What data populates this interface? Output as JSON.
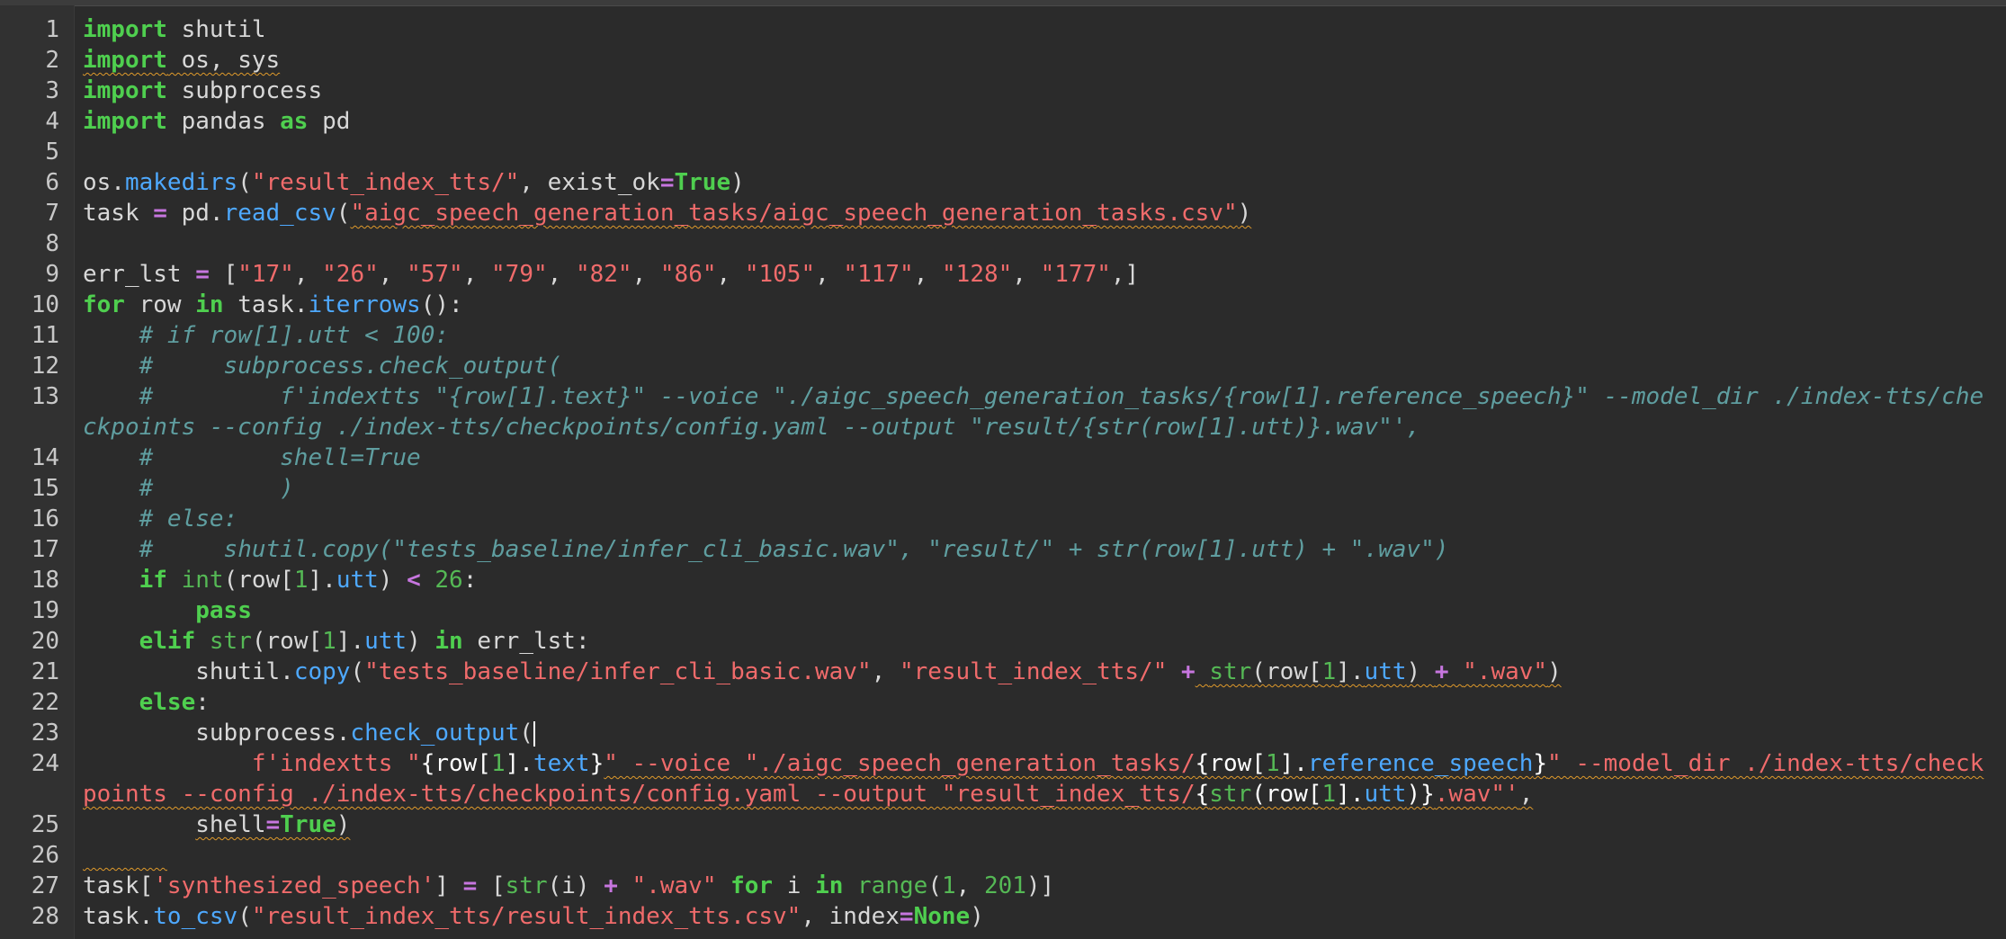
{
  "editor": {
    "language": "python",
    "colors": {
      "background": "#2b2b2b",
      "gutter": "#313131",
      "keyword": "#4fcf4f",
      "function": "#4ea9ff",
      "string": "#f06b6b",
      "operator": "#c776df",
      "comment": "#5f9ea0",
      "warning_underline": "#e09a2b"
    },
    "cursor": {
      "line": 23,
      "after_text": "subprocess.check_output("
    },
    "line_numbers": [
      "1",
      "2",
      "3",
      "4",
      "5",
      "6",
      "7",
      "8",
      "9",
      "10",
      "11",
      "12",
      "13",
      "14",
      "15",
      "16",
      "17",
      "18",
      "19",
      "20",
      "21",
      "22",
      "23",
      "24",
      "25",
      "26",
      "27",
      "28"
    ],
    "code": {
      "l1": {
        "kw": "import",
        "rest": " shutil"
      },
      "l2": {
        "kw": "import",
        "rest": " os, sys"
      },
      "l3": {
        "kw": "import",
        "rest": " subprocess"
      },
      "l4": {
        "kw": "import",
        "a": " pandas ",
        "kw2": "as",
        "b": " pd"
      },
      "l6": {
        "a": "os.",
        "fn": "makedirs",
        "b": "(",
        "s": "\"result_index_tts/\"",
        "c": ", exist_ok",
        "op": "=",
        "kw": "True",
        "d": ")"
      },
      "l7": {
        "a": "task ",
        "op": "=",
        "b": " pd.",
        "fn": "read_csv",
        "c": "(",
        "s": "\"aigc_speech_generation_tasks/aigc_speech_generation_tasks.csv\"",
        "d": ")"
      },
      "l9": {
        "a": "err_lst ",
        "op": "=",
        "b": " [",
        "items": [
          "\"17\"",
          "\"26\"",
          "\"57\"",
          "\"79\"",
          "\"82\"",
          "\"86\"",
          "\"105\"",
          "\"117\"",
          "\"128\"",
          "\"177\""
        ],
        "c": ",]"
      },
      "l10": {
        "kw": "for",
        "a": " row ",
        "kw2": "in",
        "b": " task.",
        "fn": "iterrows",
        "c": "():"
      },
      "l11": "    # if row[1].utt < 100:",
      "l12": "    #     subprocess.check_output(",
      "l13": "    #         f'indextts \"{row[1].text}\" --voice \"./aigc_speech_generation_tasks/{row[1].reference_speech}\" --model_dir ./index-tts/checkpoints --config ./index-tts/checkpoints/config.yaml --output \"result/{str(row[1].utt)}.wav\"',",
      "l14": "    #         shell=True",
      "l15": "    #         )",
      "l16": "    # else:",
      "l17": "    #     shutil.copy(\"tests_baseline/infer_cli_basic.wav\", \"result/\" + str(row[1].utt) + \".wav\")",
      "l18": {
        "indent": "    ",
        "kw": "if",
        "sp": " ",
        "bi": "int",
        "a": "(row[",
        "n1": "1",
        "b": "].",
        "attr": "utt",
        "c": ") ",
        "op": "<",
        "d": " ",
        "n2": "26",
        "e": ":"
      },
      "l19": {
        "indent": "        ",
        "kw": "pass"
      },
      "l20": {
        "indent": "    ",
        "kw": "elif",
        "sp": " ",
        "bi": "str",
        "a": "(row[",
        "n1": "1",
        "b": "].",
        "attr": "utt",
        "c": ") ",
        "kw2": "in",
        "d": " err_lst:"
      },
      "l21": {
        "indent": "        ",
        "a": "shutil.",
        "fn": "copy",
        "b": "(",
        "s1": "\"tests_baseline/infer_cli_basic.wav\"",
        "c": ", ",
        "s2": "\"result_index_tts/\"",
        "d": " ",
        "op": "+",
        "e": " ",
        "bi": "str",
        "f": "(row[",
        "n1": "1",
        "g": "].",
        "attr": "utt",
        "h": ") ",
        "op2": "+",
        "i": " ",
        "s3": "\".wav\"",
        "j": ")"
      },
      "l22": {
        "indent": "    ",
        "kw": "else",
        "rest": ":"
      },
      "l23": {
        "indent": "        ",
        "a": "subprocess.",
        "fn": "check_output",
        "b": "("
      },
      "l24": {
        "indent": "            ",
        "s1": "f'indextts \"",
        "a": "{row[",
        "n1": "1",
        "b": "].",
        "attr1": "text",
        "c": "}",
        "s2": "\" --voice \"./aigc_speech_generation_tasks/",
        "d": "{row[",
        "n2": "1",
        "e": "].",
        "attr2": "reference_speech",
        "f": "}",
        "s3": "\" --model_dir ./index-tts/checkpoints --config ./index-tts/checkpoints/config.yaml --output \"result_index_tts/",
        "g": "{",
        "bi": "str",
        "h": "(row[",
        "n3": "1",
        "i": "].",
        "attr3": "utt",
        "j": ")}",
        "s4": ".wav\"'",
        "k": ","
      },
      "l25": {
        "indent": "        ",
        "a": "shell",
        "op": "=",
        "kw": "True",
        "b": ")"
      },
      "l26": "      ",
      "l27": {
        "a": "task[",
        "s1": "'synthesized_speech'",
        "b": "] ",
        "op": "=",
        "c": " [",
        "bi": "str",
        "d": "(i) ",
        "op2": "+",
        "e": " ",
        "s2": "\".wav\"",
        "f": " ",
        "kw": "for",
        "g": " i ",
        "kw2": "in",
        "h": " ",
        "bi2": "range",
        "i": "(",
        "n1": "1",
        "j": ", ",
        "n2": "201",
        "k": ")]"
      },
      "l28": {
        "a": "task.",
        "fn": "to_csv",
        "b": "(",
        "s": "\"result_index_tts/result_index_tts.csv\"",
        "c": ", index",
        "op": "=",
        "kw": "None",
        "d": ")"
      }
    }
  }
}
